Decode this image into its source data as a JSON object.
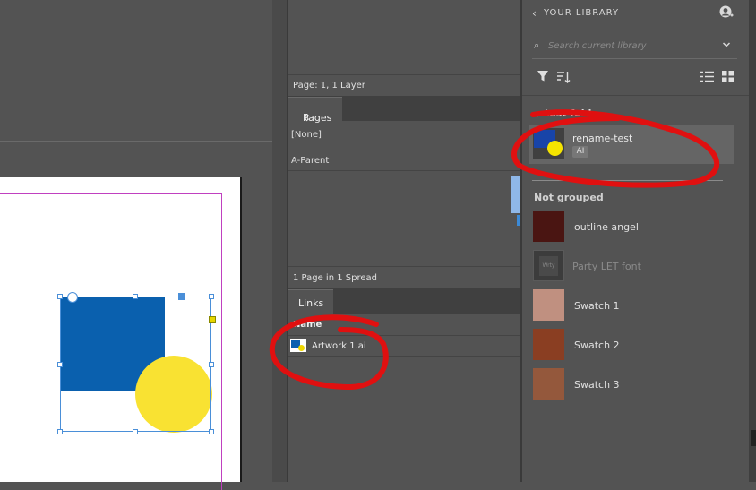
{
  "layers_panel": {
    "status": "Page: 1, 1 Layer"
  },
  "pages_panel": {
    "tab_label": "Pages",
    "none_label": "[None]",
    "parent_label": "A-Parent",
    "status": "1 Page in 1 Spread"
  },
  "links_panel": {
    "tab_label": "Links",
    "column_name": "Name",
    "items": [
      {
        "name": "Artwork 1.ai"
      }
    ]
  },
  "library_panel": {
    "back_glyph": "‹",
    "title": "YOUR LIBRARY",
    "search_placeholder": "Search current library",
    "folder": {
      "name": "test fold",
      "items": [
        {
          "name": "rename-test",
          "badge": "AI",
          "selected": true
        }
      ]
    },
    "not_grouped_label": "Not grouped",
    "items": [
      {
        "name": "outline angel",
        "color": "#4a1512"
      },
      {
        "name": "Party LET font",
        "thumb_text": "Wrty"
      },
      {
        "name": "Swatch 1",
        "color": "#c09080"
      },
      {
        "name": "Swatch 2",
        "color": "#8a3e22"
      },
      {
        "name": "Swatch 3",
        "color": "#94583c"
      }
    ]
  },
  "artwork": {
    "square_color": "#0a60ae",
    "circle_color": "#f9e232"
  },
  "annotation_color": "#e01010"
}
